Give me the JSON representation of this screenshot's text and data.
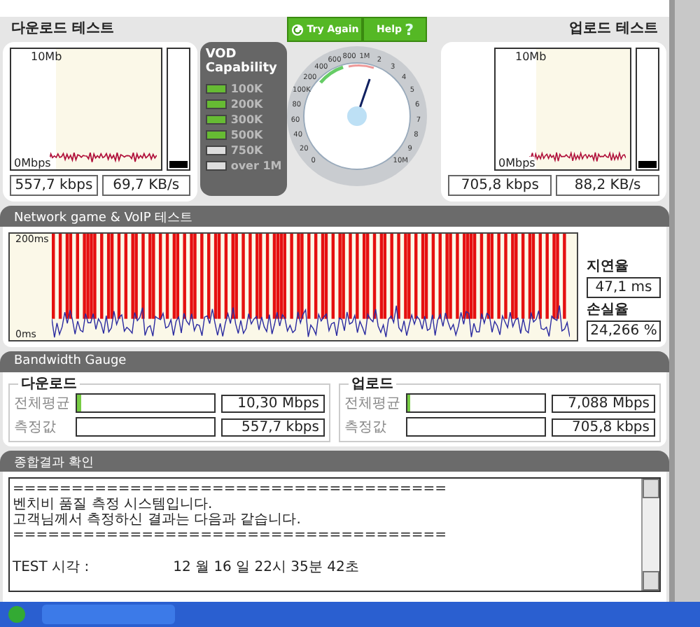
{
  "download_test": {
    "title": "다운로드 테스트",
    "y_top": "10Mb",
    "y_bottom": "0Mbps",
    "level": 0.06,
    "rate": "557,7 kbps",
    "throughput": "69,7 KB/s"
  },
  "vod": {
    "title": "VOD Capability",
    "items": [
      {
        "label": "100K",
        "on": true
      },
      {
        "label": "200K",
        "on": true
      },
      {
        "label": "300K",
        "on": true
      },
      {
        "label": "500K",
        "on": true
      },
      {
        "label": "750K",
        "on": false
      },
      {
        "label": "over 1M",
        "on": false
      }
    ]
  },
  "gauge": {
    "buttons": [
      {
        "label": "Try Again",
        "kind": "refresh"
      },
      {
        "label": "Help",
        "kind": "help"
      }
    ],
    "help_glyph": "?",
    "dial_labels": [
      "800",
      "1M",
      "600",
      "2",
      "400",
      "3",
      "200",
      "4",
      "100K",
      "5",
      "80",
      "6",
      "60",
      "7",
      "40",
      "8",
      "20",
      "9",
      "0",
      "10M"
    ],
    "level": 0.57
  },
  "upload_test": {
    "title": "업로드 테스트",
    "y_top": "10Mb",
    "y_bottom": "0Mbps",
    "level": 0.06,
    "rate": "705,8 kbps",
    "throughput": "88,2 KB/s"
  },
  "network_test": {
    "title": "Network game & VoIP 테스트",
    "y_top": "200ms",
    "y_bottom": "0ms",
    "latency_label": "지연율",
    "latency": "47,1 ms",
    "loss_label": "손실율",
    "loss": "24,266 %"
  },
  "bandwidth": {
    "title": "Bandwidth Gauge",
    "groups": [
      {
        "title": "다운로드",
        "rows": [
          {
            "label": "전체평균",
            "level": 0.03,
            "value": "10,30 Mbps"
          },
          {
            "label": "측정값",
            "value": "557,7 kbps"
          }
        ]
      },
      {
        "title": "업로드",
        "rows": [
          {
            "label": "전체평균",
            "level": 0.02,
            "value": "7,088 Mbps"
          },
          {
            "label": "측정값",
            "value": "705,8 kbps"
          }
        ]
      }
    ]
  },
  "summary": {
    "title": "종합결과 확인",
    "lines": [
      "=====================================",
      "벤치비 품질 측정 시스템입니다.",
      "고객님께서 측정하신 결과는 다음과 같습니다.",
      "====================================="
    ],
    "test_time_label": "TEST 시각 :",
    "test_time": "12 월 16 일  22시 35분 42초"
  }
}
